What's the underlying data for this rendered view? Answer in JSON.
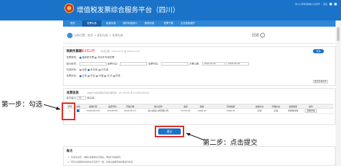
{
  "header": {
    "title": "增值税发票综合服务平台（四川）",
    "user_info": "四川公司测试纳税人识别号 ｜ 退出"
  },
  "nav": {
    "items": [
      "首页",
      "发票勾选",
      "批量勾选",
      "抵扣勾选统计",
      "退税勾选",
      "发票下载",
      "企业信息维护"
    ]
  },
  "breadcrumb": {
    "text": "当前位置：首页 > 抵扣勾选 > 发票勾选",
    "back_label": "回退"
  },
  "query": {
    "section_title": "税款所属期：",
    "period": "2020年2月",
    "period_note": "（勾选日期：2020-03-01 至 2020-03-16）",
    "query_button": "查询",
    "invoice_type_label": "发票类型：",
    "invoice_type_options": [
      "增值税专票",
      "机动车专用发票"
    ],
    "seller_taxid_label": "销方税号：",
    "invoice_code_label": "发票代码：",
    "invoice_number_label": "发票号码：",
    "date_label": "开票日期：",
    "date_from": "2020-01-01",
    "date_to": "2020-02-29",
    "status_label": "勾选状态：",
    "status_options": [
      "全部",
      "未勾选",
      "已勾选"
    ],
    "invoice_status_label": "发票状态：",
    "invoice_status_options": [
      "正常",
      "失控",
      "作废",
      "红冲",
      "异常"
    ],
    "more_link": "更多查询条件"
  },
  "table": {
    "section_title": "发票信息",
    "note": "（当前可勾选发票的开票日期范围：2017年7月1日-2020年2月29日）",
    "page_size_label": "每页显示",
    "page_size": "50",
    "page_size_suffix": "条记录",
    "columns": [
      "序号",
      "勾选",
      "发票代码",
      "发票号码",
      "开票日期",
      "销方名称",
      "金额",
      "税额",
      "有效税额",
      "发票状态",
      "管理状态",
      "发票类型",
      "操作"
    ],
    "rows": [
      [
        "1",
        "",
        "5100191130",
        "12418750",
        "2020-01-13",
        "四川某某公司有限公司",
        "57755.00",
        "2264.15",
        "2264.15",
        "正常",
        "正常",
        "增值税专票",
        "查看详情"
      ]
    ],
    "submit_label": "提交"
  },
  "annotations": {
    "step1": "第一步：勾选",
    "step2": "第二步：点击提交"
  },
  "notes": {
    "title": "备注",
    "lines": [
      "1、勾选请注意：请确认发票信息无误后，再进行勾选操作。",
      "2、若平台发票的勾选状态与实际不一致，请通过发票查询功能进行核实。"
    ]
  },
  "colors": {
    "header": "#1a73c9",
    "nav": "#2d87d6",
    "highlight": "#e02a23",
    "period": "#d9332b"
  }
}
